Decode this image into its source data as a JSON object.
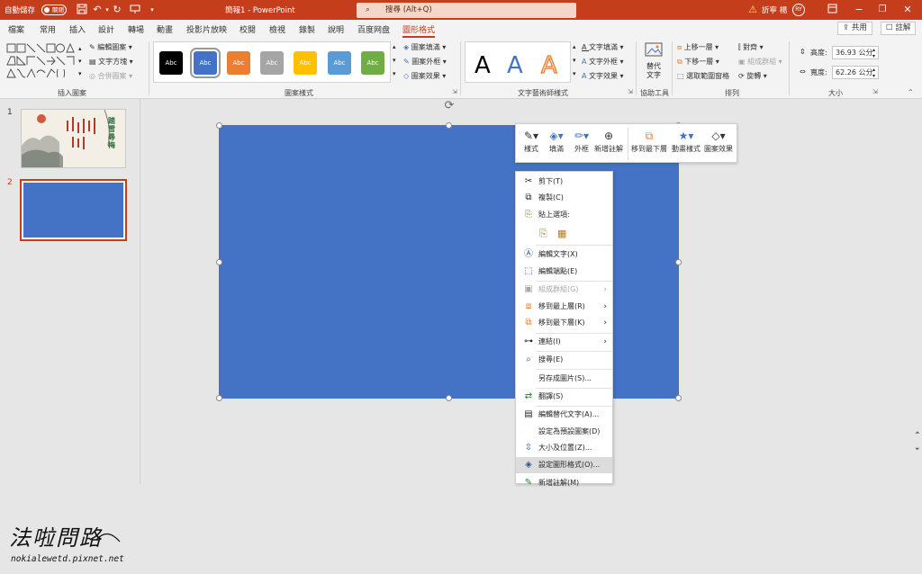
{
  "titlebar": {
    "autosave_label": "自動儲存",
    "autosave_state": "關閉",
    "doc_title": "簡報1 - PowerPoint",
    "search_placeholder": "搜尋 (Alt+Q)",
    "user_name": "訢寧 楊",
    "user_initials": "RY"
  },
  "tabs": [
    "檔案",
    "常用",
    "插入",
    "設計",
    "轉場",
    "動畫",
    "投影片放映",
    "校閱",
    "檢視",
    "錄製",
    "說明",
    "百度网盘",
    "圖形格式"
  ],
  "header_buttons": {
    "share": "共用",
    "comment": "註解"
  },
  "ribbon": {
    "insert_shapes": {
      "label": "插入圖案",
      "edit_shape": "編輯圖案",
      "text_box": "文字方塊",
      "merge_shapes": "合併圖案"
    },
    "shape_styles": {
      "label": "圖案樣式",
      "swatch_text": "Abc",
      "swatches": [
        "#000000",
        "#4472c4",
        "#ed7d31",
        "#a5a5a5",
        "#ffc000",
        "#5b9bd5",
        "#70ad47"
      ],
      "fill": "圖案填滿",
      "outline": "圖案外框",
      "effects": "圖案效果"
    },
    "wordart": {
      "label": "文字藝術師樣式",
      "sample": "A",
      "text_fill": "文字填滿",
      "text_outline": "文字外框",
      "text_effects": "文字效果"
    },
    "accessibility": {
      "label": "協助工具",
      "alt_text_line1": "替代",
      "alt_text_line2": "文字"
    },
    "arrange": {
      "label": "排列",
      "bring_forward": "上移一層",
      "send_backward": "下移一層",
      "selection_pane": "選取範圍窗格",
      "align": "對齊",
      "group": "組成群組",
      "rotate": "旋轉"
    },
    "size": {
      "label": "大小",
      "height_label": "高度:",
      "height_value": "36.93 公分",
      "width_label": "寬度:",
      "width_value": "62.26 公分"
    }
  },
  "slides": [
    {
      "number": "1"
    },
    {
      "number": "2"
    }
  ],
  "slide1_thumb": {
    "title_text": "踏雪尋梅"
  },
  "mini_toolbar": [
    "樣式",
    "填滿",
    "外框",
    "新增註解",
    "移到最下層",
    "動畫樣式",
    "圖案效果"
  ],
  "context_menu": [
    {
      "icon": "scissors-icon",
      "glyph": "✂",
      "label": "剪下(T)"
    },
    {
      "icon": "copy-icon",
      "glyph": "⧉",
      "label": "複製(C)"
    },
    {
      "icon": "paste-icon",
      "glyph": "📋",
      "label": "貼上選項:"
    },
    {
      "icon": "edit-text-icon",
      "glyph": "A",
      "label": "編輯文字(X)"
    },
    {
      "icon": "edit-points-icon",
      "glyph": "⬚",
      "label": "編輯端點(E)"
    },
    {
      "icon": "group-icon",
      "glyph": "▣",
      "label": "組成群組(G)",
      "disabled": true,
      "submenu": true
    },
    {
      "icon": "bring-to-front-icon",
      "glyph": "⧈",
      "label": "移到最上層(R)",
      "submenu": true
    },
    {
      "icon": "send-to-back-icon",
      "glyph": "⧉",
      "label": "移到最下層(K)",
      "submenu": true
    },
    {
      "icon": "link-icon",
      "glyph": "⛓",
      "label": "連結(I)",
      "submenu": true
    },
    {
      "icon": "search-icon",
      "glyph": "⌕",
      "label": "搜尋(E)"
    },
    {
      "icon": "",
      "glyph": "",
      "label": "另存成圖片(S)..."
    },
    {
      "icon": "translate-icon",
      "glyph": "⇄",
      "label": "翻譯(S)"
    },
    {
      "icon": "alt-text-icon",
      "glyph": "▤",
      "label": "編輯替代文字(A)..."
    },
    {
      "icon": "",
      "glyph": "",
      "label": "設定為預設圖案(D)"
    },
    {
      "icon": "size-position-icon",
      "glyph": "⇳",
      "label": "大小及位置(Z)..."
    },
    {
      "icon": "format-shape-icon",
      "glyph": "◈",
      "label": "設定圖形格式(O)...",
      "highlighted": true
    },
    {
      "icon": "new-comment-icon",
      "glyph": "✎",
      "label": "新增註解(M)"
    }
  ],
  "watermark": {
    "line1": "法啦問路",
    "line2": "nokialewetd.pixnet.net"
  },
  "colors": {
    "accent": "#c43e1c",
    "shape_fill": "#4472c4"
  }
}
